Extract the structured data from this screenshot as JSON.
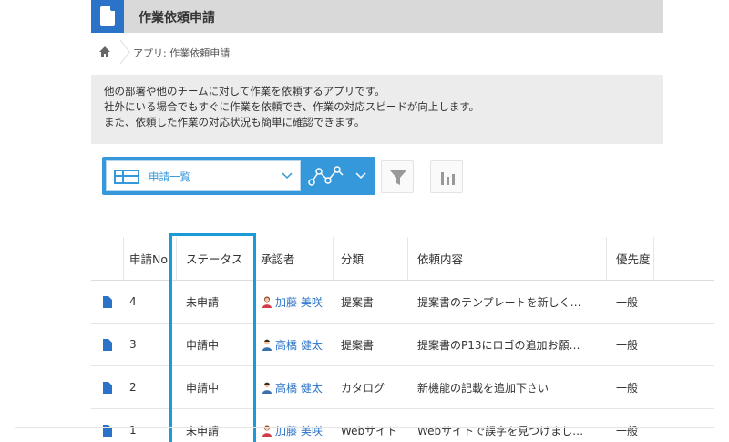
{
  "app": {
    "title": "作業依頼申請"
  },
  "breadcrumb": {
    "home_icon": "home-icon",
    "path": "アプリ: 作業依頼申請"
  },
  "description": {
    "lines": [
      "他の部署や他のチームに対して作業を依頼するアプリです。",
      "社外にいる場合でもすぐに作業を依頼でき、作業の対応スピードが向上します。",
      "また、依頼した作業の対応状況も簡単に確認できます。"
    ]
  },
  "toolbar": {
    "view_label": "申請一覧",
    "view_icon": "table-icon",
    "graph_icon": "graph-icon",
    "filter_icon": "filter-icon",
    "chart_icon": "bar-chart-icon"
  },
  "colors": {
    "accent": "#3498db",
    "header_bg": "#d9d9d9",
    "desc_bg": "#ececec",
    "highlight": "#1a9ad6",
    "link": "#2a73c8"
  },
  "table": {
    "headers": {
      "no": "申請No",
      "status": "ステータス",
      "approver": "承認者",
      "category": "分類",
      "content": "依頼内容",
      "priority": "優先度"
    },
    "rows": [
      {
        "no": "4",
        "status": "未申請",
        "approver": "加藤 美咲",
        "approver_icon": "female-user-icon",
        "category": "提案書",
        "content": "提案書のテンプレートを新しく…",
        "priority": "一般"
      },
      {
        "no": "3",
        "status": "申請中",
        "approver": "高橋 健太",
        "approver_icon": "male-user-icon",
        "category": "提案書",
        "content": "提案書のP13にロゴの追加お願…",
        "priority": "一般"
      },
      {
        "no": "2",
        "status": "申請中",
        "approver": "高橋 健太",
        "approver_icon": "male-user-icon",
        "category": "カタログ",
        "content": "新機能の記載を追加下さい",
        "priority": "一般"
      },
      {
        "no": "1",
        "status": "未申請",
        "approver": "加藤 美咲",
        "approver_icon": "female-user-icon",
        "category": "Webサイト",
        "content": "Webサイトで誤字を見つけまし…",
        "priority": "一般"
      }
    ]
  }
}
